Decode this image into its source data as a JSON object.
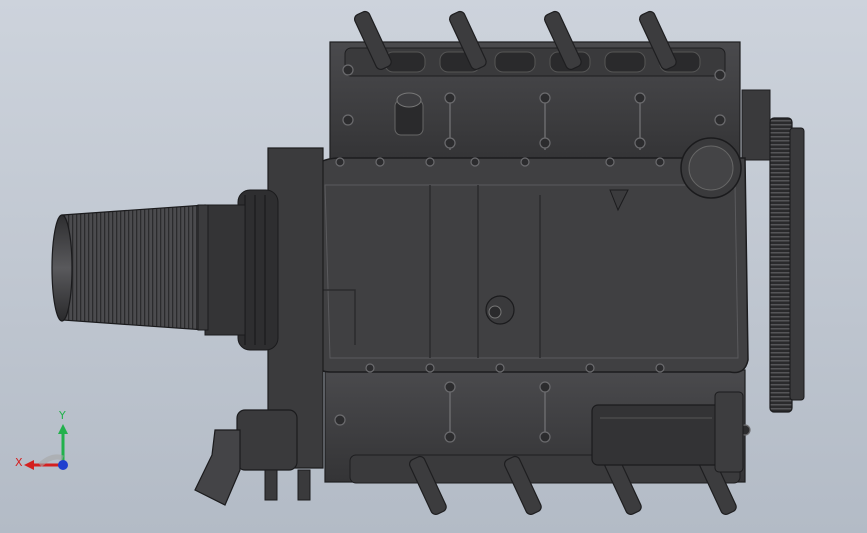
{
  "viewport": {
    "background_top": "#cdd3dc",
    "background_bottom": "#b3bbc6"
  },
  "model": {
    "description_icon": "engine-assembly-icon",
    "body_color": "#3f3f41",
    "dark_color": "#2c2c2e",
    "highlight_color": "#5a5a5d"
  },
  "triad": {
    "y_label": "Y",
    "x_label": "X",
    "y_color": "#22b14c",
    "x_color": "#d42020",
    "z_color": "#1f3fcf"
  }
}
